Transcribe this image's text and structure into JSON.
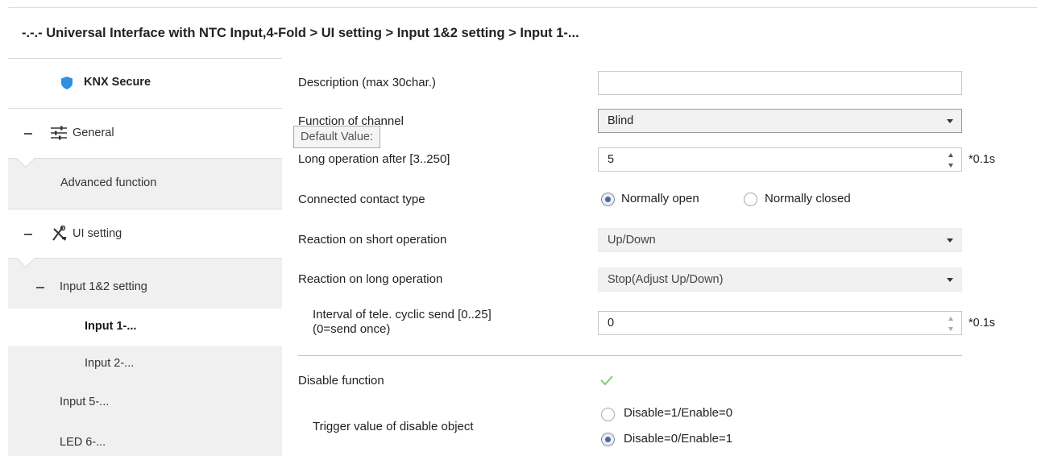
{
  "window": {
    "title": "-.-.- Universal Interface with NTC Input,4-Fold > UI setting > Input 1&2 setting > Input 1-..."
  },
  "sidebar": {
    "knx_secure": "KNX Secure",
    "general": "General",
    "advanced_function": "Advanced function",
    "ui_setting": "UI setting",
    "input12_setting": "Input 1&2 setting",
    "input1": "Input 1-...",
    "input2": "Input 2-...",
    "input5": "Input 5-...",
    "led6": "LED 6-..."
  },
  "form": {
    "description": {
      "label": "Description (max 30char.)",
      "value": ""
    },
    "function_of_channel": {
      "label": "Function of channel",
      "value": "Blind"
    },
    "tooltip": "Default Value:",
    "long_operation": {
      "label": "Long operation after [3..250]",
      "value": "5",
      "unit": "*0.1s"
    },
    "contact_type": {
      "label": "Connected contact type",
      "option1": "Normally open",
      "option2": "Normally closed",
      "selected": "Normally open"
    },
    "reaction_short": {
      "label": "Reaction on short operation",
      "value": "Up/Down"
    },
    "reaction_long": {
      "label": "Reaction on long operation",
      "value": "Stop(Adjust Up/Down)"
    },
    "interval_cyclic": {
      "label_line1": "Interval of tele. cyclic send [0..25]",
      "label_line2": "(0=send once)",
      "value": "0",
      "unit": "*0.1s"
    },
    "disable_function": {
      "label": "Disable function",
      "checked": true
    },
    "trigger_value": {
      "label": "Trigger value of disable object",
      "option1": "Disable=1/Enable=0",
      "option2": "Disable=0/Enable=1",
      "selected": "Disable=0/Enable=1"
    }
  },
  "colors": {
    "shield": "#2f8fe0",
    "selected_text": "#1a1a1a",
    "check": "#7fc97f"
  }
}
